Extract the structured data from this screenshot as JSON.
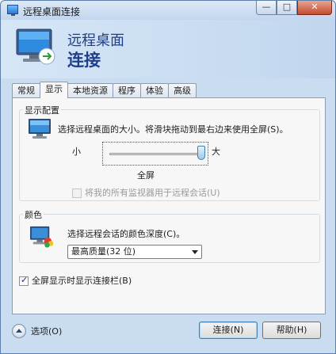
{
  "window": {
    "title": "远程桌面连接",
    "buttons": {
      "minimize": "—",
      "maximize": "□",
      "close": "✕"
    }
  },
  "header": {
    "line1": "远程桌面",
    "line2": "连接"
  },
  "tabs": [
    {
      "label": "常规",
      "active": false
    },
    {
      "label": "显示",
      "active": true
    },
    {
      "label": "本地资源",
      "active": false
    },
    {
      "label": "程序",
      "active": false
    },
    {
      "label": "体验",
      "active": false
    },
    {
      "label": "高级",
      "active": false
    }
  ],
  "display_config": {
    "group_label": "显示配置",
    "description": "选择远程桌面的大小。将滑块拖动到最右边来使用全屏(S)。",
    "slider_min_label": "小",
    "slider_max_label": "大",
    "slider_value_label": "全屏",
    "slider_fraction": 1.0,
    "monitors_checkbox_label": "将我的所有监视器用于远程会话(U)",
    "monitors_checkbox_checked": false,
    "monitors_checkbox_enabled": false
  },
  "colors": {
    "group_label": "颜色",
    "description": "选择远程会话的颜色深度(C)。",
    "selected_value": "最高质量(32 位)"
  },
  "connection_bar": {
    "label": "全屏显示时显示连接栏(B)",
    "checked": true
  },
  "footer": {
    "options_label": "选项(O)",
    "connect_button": "连接(N)",
    "help_button": "帮助(H)"
  },
  "icons": {
    "app": "remote-desktop-icon",
    "header": "remote-desktop-monitor-icon",
    "display": "monitor-icon",
    "colors": "color-monitor-icon",
    "options": "chevron-up-icon"
  },
  "theme": {
    "accent": "#1f3f8a",
    "chrome": "#c9dcf0"
  }
}
